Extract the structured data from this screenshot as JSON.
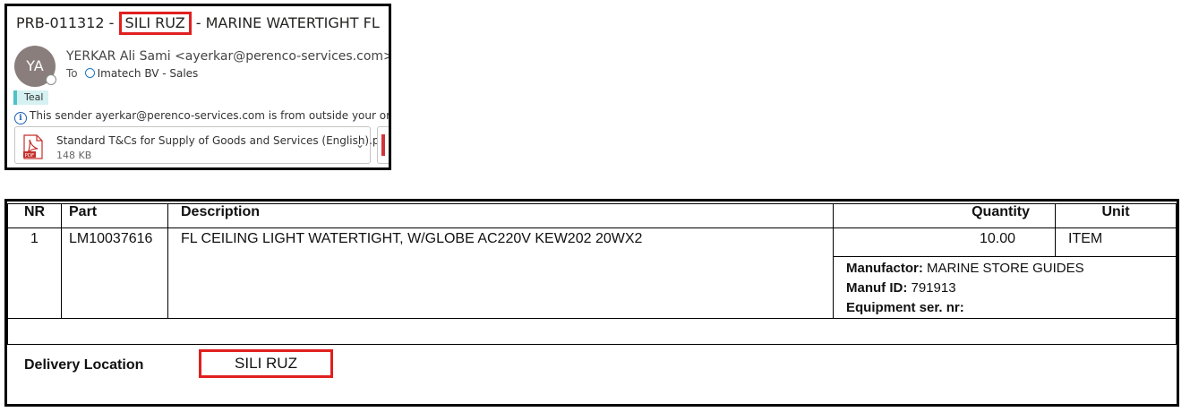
{
  "email": {
    "subject_prefix": "PRB-011312 - ",
    "subject_highlight": "SILI RUZ",
    "subject_suffix": " - MARINE WATERTIGHT FL",
    "avatar_initials": "YA",
    "sender": "YERKAR Ali Sami <ayerkar@perenco-services.com>",
    "to_label": "To",
    "recipient": "Imatech BV - Sales",
    "category_tag": "Teal",
    "external_notice": "This sender ayerkar@perenco-services.com is from outside your organization.",
    "attachment": {
      "name": "Standard T&Cs for Supply of Goods and Services (English).pdf",
      "size": "148 KB",
      "icon": "pdf-icon"
    }
  },
  "order": {
    "headers": {
      "nr": "NR",
      "part": "Part",
      "description": "Description",
      "quantity": "Quantity",
      "unit": "Unit"
    },
    "rows": [
      {
        "nr": "1",
        "part": "LM10037616",
        "description": "FL CEILING LIGHT WATERTIGHT, W/GLOBE AC220V KEW202 20WX2",
        "quantity": "10.00",
        "unit": "ITEM",
        "manufactor_label": "Manufactor:",
        "manufactor": "MARINE STORE GUIDES",
        "manuf_id_label": "Manuf ID:",
        "manuf_id": "791913",
        "equipment_label": "Equipment ser. nr:",
        "equipment": ""
      }
    ],
    "delivery_label": "Delivery Location",
    "delivery_value": "SILI RUZ"
  },
  "colors": {
    "highlight_border": "#e0201f",
    "avatar_bg": "#8a7e7c",
    "tag_bg": "#d6f1f1",
    "tag_accent": "#4fc1c7"
  }
}
